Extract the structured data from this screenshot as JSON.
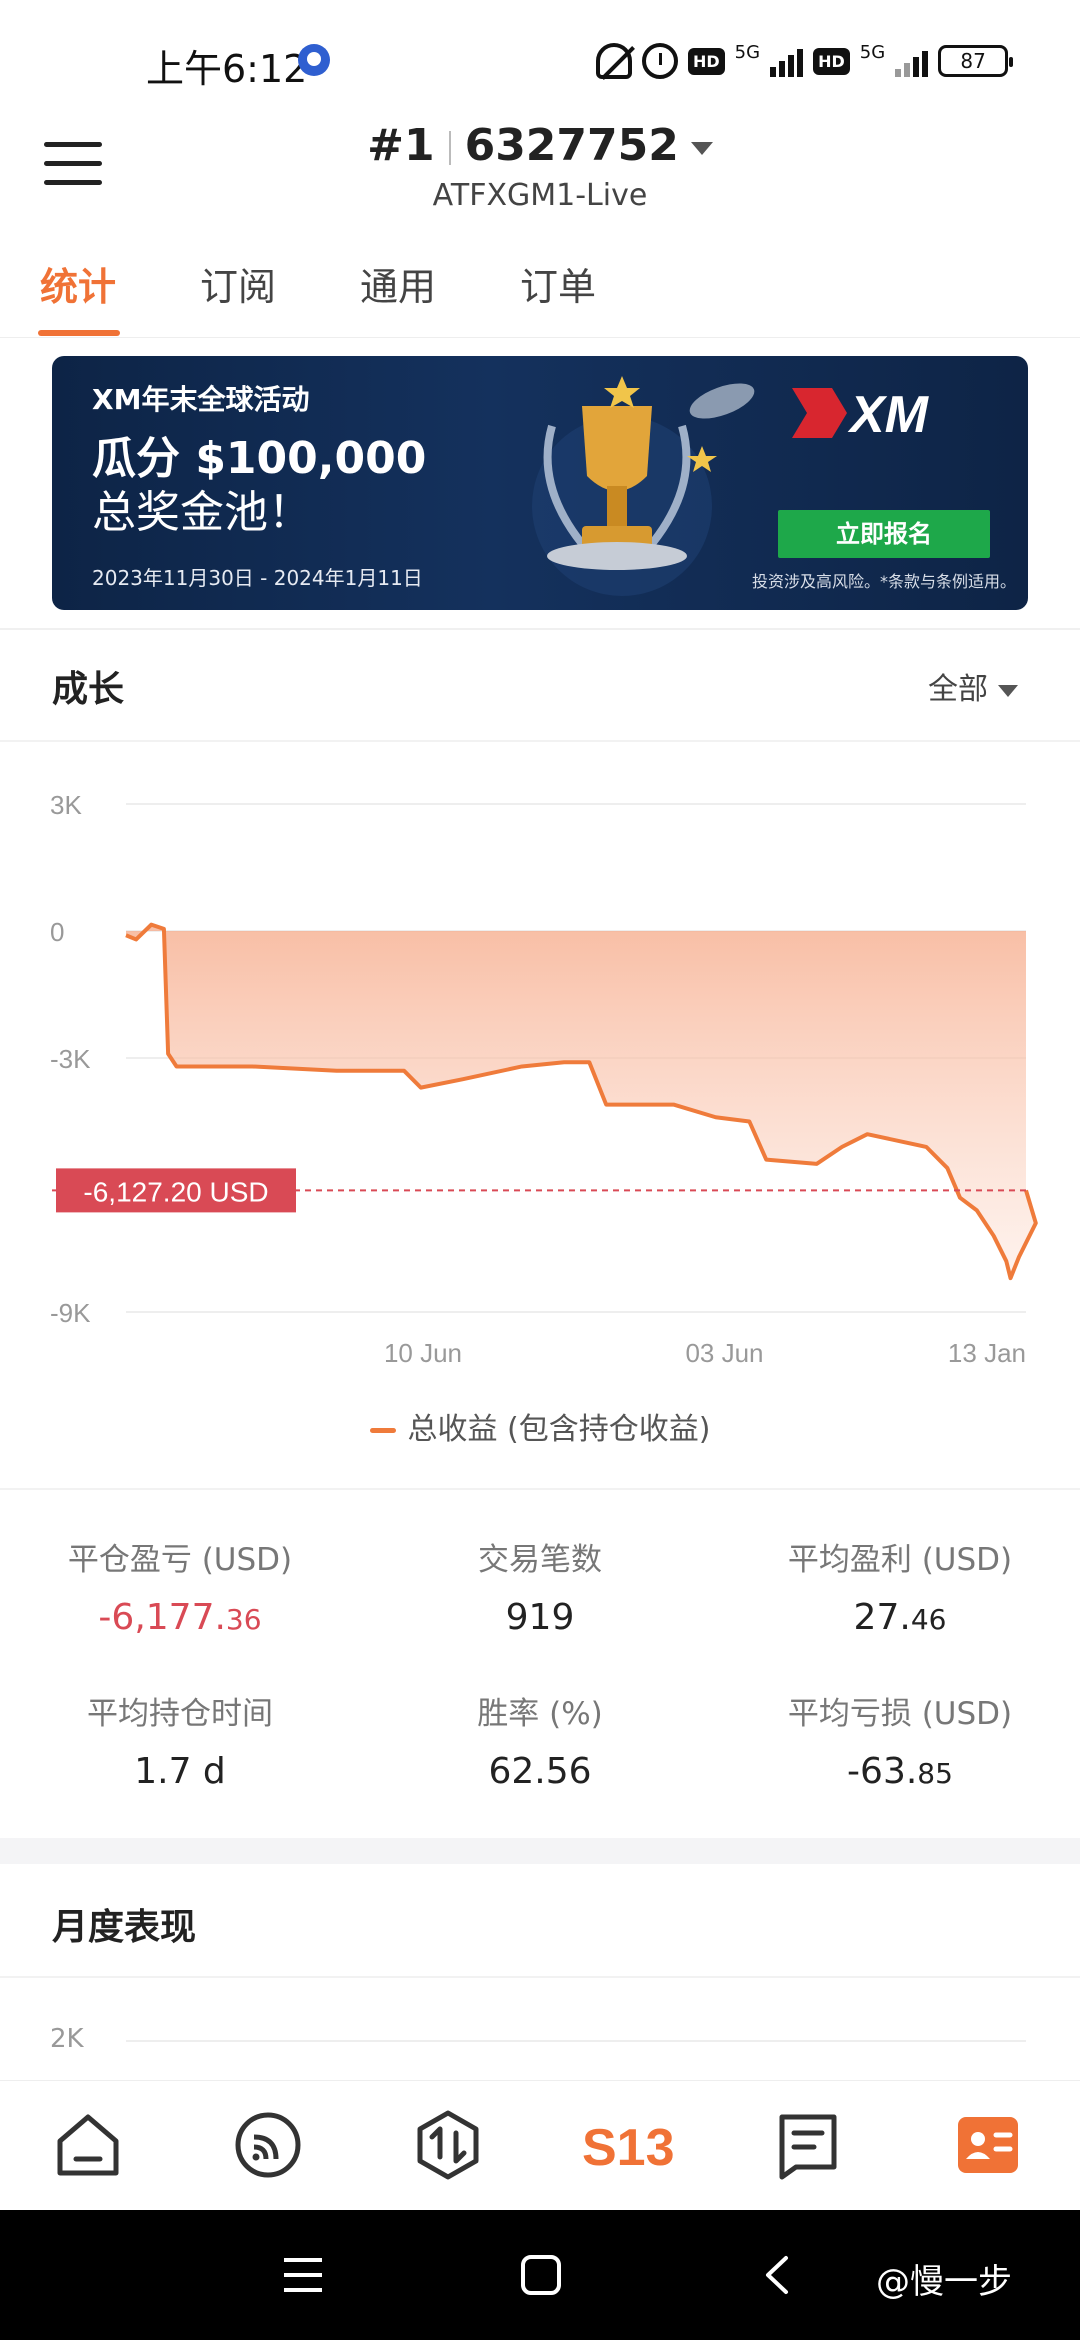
{
  "status_bar": {
    "time": "上午6:12",
    "battery": "87",
    "network_label": "5G",
    "hd_label": "HD",
    "icons": [
      "alarm-icon",
      "mute-bell-icon",
      "alarm-clock-icon",
      "hd-icon",
      "signal-icon",
      "battery-icon"
    ]
  },
  "header": {
    "rank": "#1",
    "account_id": "6327752",
    "server": "ATFXGM1-Live"
  },
  "tabs": [
    {
      "label": "统计",
      "active": true
    },
    {
      "label": "订阅",
      "active": false
    },
    {
      "label": "通用",
      "active": false
    },
    {
      "label": "订单",
      "active": false
    }
  ],
  "banner": {
    "title": "XM年末全球活动",
    "amount_line": "瓜分 $100,000",
    "pool_line": "总奖金池！",
    "dates": "2023年11月30日 - 2024年1月11日",
    "button": "立即报名",
    "note": "投资涉及高风险。*条款与条例适用。",
    "brand": "XM"
  },
  "growth": {
    "title": "成长",
    "filter": "全部",
    "current_label": "-6,127.20 USD"
  },
  "chart_data": {
    "type": "area",
    "series": [
      {
        "name": "总收益 (包含持仓收益)",
        "color": "#ef7b3b",
        "points": [
          [
            0.0,
            -100
          ],
          [
            0.012,
            -200
          ],
          [
            0.03,
            150
          ],
          [
            0.045,
            50
          ],
          [
            0.05,
            -2900
          ],
          [
            0.06,
            -3200
          ],
          [
            0.15,
            -3200
          ],
          [
            0.25,
            -3300
          ],
          [
            0.33,
            -3300
          ],
          [
            0.35,
            -3700
          ],
          [
            0.4,
            -3500
          ],
          [
            0.47,
            -3200
          ],
          [
            0.52,
            -3100
          ],
          [
            0.55,
            -3100
          ],
          [
            0.57,
            -4100
          ],
          [
            0.65,
            -4100
          ],
          [
            0.7,
            -4400
          ],
          [
            0.74,
            -4500
          ],
          [
            0.76,
            -5400
          ],
          [
            0.82,
            -5500
          ],
          [
            0.85,
            -5100
          ],
          [
            0.88,
            -4800
          ],
          [
            0.95,
            -5100
          ],
          [
            0.975,
            -5600
          ],
          [
            0.99,
            -6300
          ],
          [
            1.01,
            -6600
          ],
          [
            1.03,
            -7200
          ],
          [
            1.045,
            -7800
          ],
          [
            1.05,
            -8200
          ],
          [
            1.06,
            -7700
          ],
          [
            1.08,
            -6900
          ],
          [
            1.0,
            -6127.2
          ]
        ]
      }
    ],
    "ylim": [
      -9000,
      3000
    ],
    "yticks": [
      "3K",
      "0",
      "-3K",
      "-9K"
    ],
    "xticks": [
      "10 Jun",
      "03 Jun",
      "13 Jan"
    ],
    "current_value": -6127.2,
    "current_label": "-6,127.20 USD",
    "grid": true,
    "legend": "bottom-center"
  },
  "stats": [
    {
      "label": "平仓盈亏 (USD)",
      "value": "-6,177.",
      "decimals": "36",
      "negative": true
    },
    {
      "label": "交易笔数",
      "value": "919",
      "decimals": "",
      "negative": false
    },
    {
      "label": "平均盈利 (USD)",
      "value": "27.",
      "decimals": "46",
      "negative": false
    },
    {
      "label": "平均持仓时间",
      "value": "1.7 d",
      "decimals": "",
      "negative": false
    },
    {
      "label": "胜率 (%)",
      "value": "62.56",
      "decimals": "",
      "negative": false
    },
    {
      "label": "平均亏损 (USD)",
      "value": "-63.",
      "decimals": "85",
      "negative": false
    }
  ],
  "monthly": {
    "title": "月度表现",
    "first_tick": "2K"
  },
  "bottom_nav": [
    {
      "icon": "home-icon"
    },
    {
      "icon": "signal-feed-icon"
    },
    {
      "icon": "trade-icon"
    },
    {
      "icon": "s13-logo-icon",
      "label": "S13"
    },
    {
      "icon": "message-icon"
    },
    {
      "icon": "profile-card-icon",
      "active": true
    }
  ],
  "system_nav": {
    "watermark": "@慢一步"
  }
}
